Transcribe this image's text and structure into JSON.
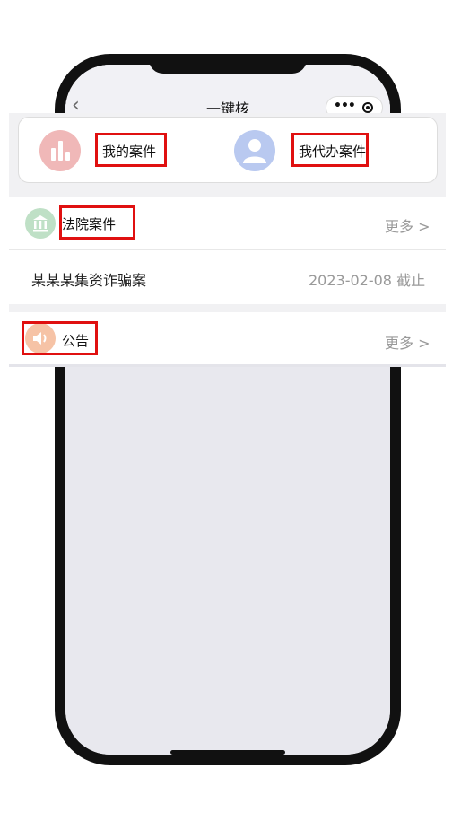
{
  "nav": {
    "title": "一键核",
    "back_icon": "chevron-left-icon",
    "more_icon": "more-dots-icon",
    "close_icon": "target-icon"
  },
  "quick_actions": [
    {
      "label": "我的案件",
      "icon": "bar-chart-icon",
      "icon_color": "#f0b8b8"
    },
    {
      "label": "我代办案件",
      "icon": "user-icon",
      "icon_color": "#b9c9f0"
    }
  ],
  "court_cases": {
    "title": "法院案件",
    "icon": "courthouse-icon",
    "more": "更多 >",
    "items": [
      {
        "name": "某某某集资诈骗案",
        "deadline": "2023-02-08 截止"
      }
    ]
  },
  "announcements": {
    "title": "公告",
    "icon": "speaker-icon",
    "more": "更多 >"
  },
  "colors": {
    "highlight": "#e01010",
    "muted_text": "#999999"
  }
}
